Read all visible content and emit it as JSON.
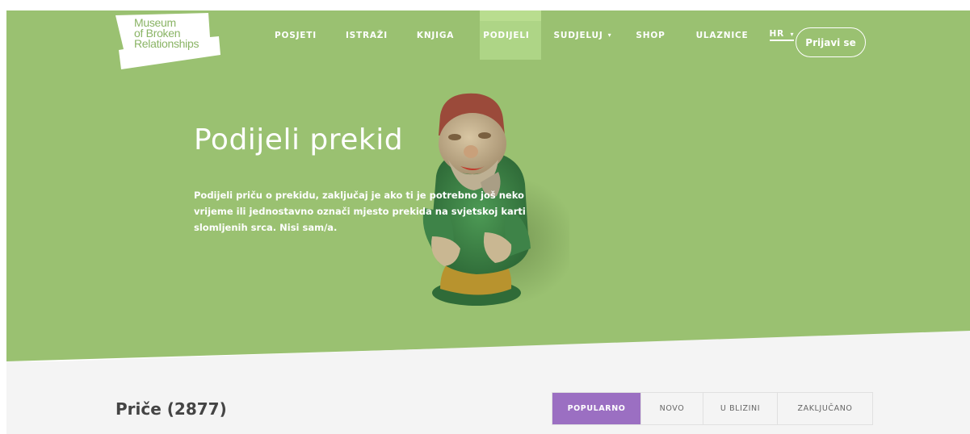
{
  "logo": {
    "line1": "Museum",
    "line2": "of Broken",
    "line3": "Relationships"
  },
  "nav": {
    "items": [
      {
        "label": "POSJETI"
      },
      {
        "label": "ISTRAŽI"
      },
      {
        "label": "KNJIGA"
      },
      {
        "label": "PODIJELI",
        "active": true
      },
      {
        "label": "SUDJELUJ",
        "caret": "▾"
      },
      {
        "label": "SHOP"
      },
      {
        "label": "ULAZNICE"
      }
    ],
    "language": "HR",
    "language_caret": "▾",
    "login_label": "Prijavi se"
  },
  "hero": {
    "title": "Podijeli prekid",
    "description": "Podijeli priču o prekidu, zaključaj je ako ti je potrebno još neko vrijeme ili jednostavno označi mjesto prekida na svjetskoj karti slomljenih srca. Nisi sam/a."
  },
  "stories": {
    "title": "Priče (2877)",
    "tabs": [
      {
        "label": "POPULARNO",
        "active": true
      },
      {
        "label": "NOVO"
      },
      {
        "label": "U BLIZINI"
      },
      {
        "label": "ZAKLJUČANO"
      }
    ]
  },
  "colors": {
    "hero_bg": "#9ac171",
    "nav_active_bg": "#aed586",
    "tab_active": "#9b6fc2",
    "bottom_bg": "#f4f4f4"
  }
}
